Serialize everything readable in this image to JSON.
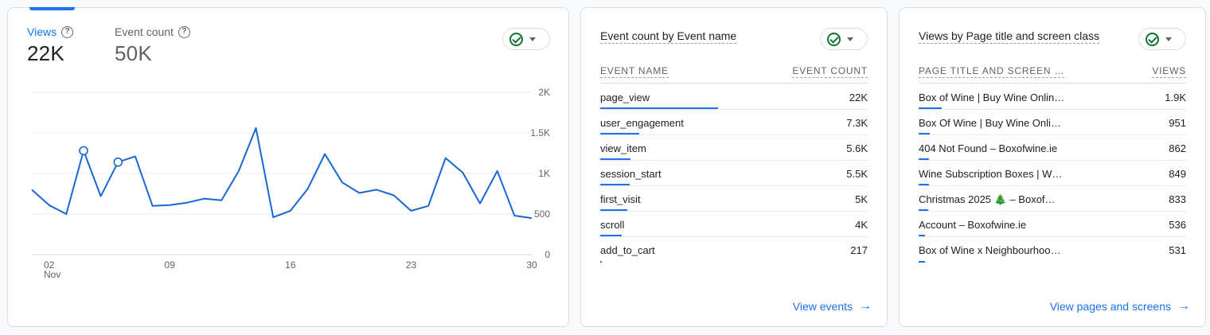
{
  "views_card": {
    "metrics": [
      {
        "label": "Views",
        "value": "22K"
      },
      {
        "label": "Event count",
        "value": "50K"
      }
    ],
    "help_glyph": "?"
  },
  "chart_data": {
    "type": "line",
    "series": [
      {
        "name": "Views",
        "values": [
          800,
          610,
          500,
          1280,
          720,
          1140,
          1210,
          600,
          610,
          640,
          690,
          670,
          1030,
          1560,
          460,
          540,
          810,
          1240,
          890,
          760,
          800,
          730,
          540,
          600,
          1190,
          1010,
          630,
          1030,
          480,
          450
        ]
      }
    ],
    "x": [
      "Nov 1",
      "Nov 2",
      "Nov 3",
      "Nov 4",
      "Nov 5",
      "Nov 6",
      "Nov 7",
      "Nov 8",
      "Nov 9",
      "Nov 10",
      "Nov 11",
      "Nov 12",
      "Nov 13",
      "Nov 14",
      "Nov 15",
      "Nov 16",
      "Nov 17",
      "Nov 18",
      "Nov 19",
      "Nov 20",
      "Nov 21",
      "Nov 22",
      "Nov 23",
      "Nov 24",
      "Nov 25",
      "Nov 26",
      "Nov 27",
      "Nov 28",
      "Nov 29",
      "Nov 30"
    ],
    "x_ticks": [
      {
        "label": "02",
        "sub": "Nov"
      },
      {
        "label": "09",
        "sub": ""
      },
      {
        "label": "16",
        "sub": ""
      },
      {
        "label": "23",
        "sub": ""
      },
      {
        "label": "30",
        "sub": ""
      }
    ],
    "x_tick_days": [
      2,
      9,
      16,
      23,
      30
    ],
    "y_ticks": [
      "0",
      "500",
      "1K",
      "1.5K",
      "2K"
    ],
    "y_tick_values": [
      0,
      500,
      1000,
      1500,
      2000
    ],
    "ylim": [
      0,
      2000
    ],
    "annotation_days": [
      4,
      6
    ],
    "grid": true,
    "line_color": "#1967d2"
  },
  "events_card": {
    "title": "Event count by Event name",
    "col_left": "EVENT NAME",
    "col_right": "EVENT COUNT",
    "rows": [
      {
        "name": "page_view",
        "value": "22K",
        "fraction": 0.44
      },
      {
        "name": "user_engagement",
        "value": "7.3K",
        "fraction": 0.146
      },
      {
        "name": "view_item",
        "value": "5.6K",
        "fraction": 0.112
      },
      {
        "name": "session_start",
        "value": "5.5K",
        "fraction": 0.11
      },
      {
        "name": "first_visit",
        "value": "5K",
        "fraction": 0.1
      },
      {
        "name": "scroll",
        "value": "4K",
        "fraction": 0.08
      },
      {
        "name": "add_to_cart",
        "value": "217",
        "fraction": 0.005
      }
    ],
    "link": "View events"
  },
  "pages_card": {
    "title": "Views by Page title and screen class",
    "col_left": "PAGE TITLE AND SCREEN …",
    "col_right": "VIEWS",
    "rows": [
      {
        "name": "Box of Wine | Buy Wine Onlin…",
        "value": "1.9K",
        "fraction": 0.086
      },
      {
        "name": "Box Of Wine | Buy Wine Onli…",
        "value": "951",
        "fraction": 0.043
      },
      {
        "name": "404 Not Found – Boxofwine.ie",
        "value": "862",
        "fraction": 0.039
      },
      {
        "name": "Wine Subscription Boxes | W…",
        "value": "849",
        "fraction": 0.038
      },
      {
        "name": "Christmas 2025 🎄 – Boxof…",
        "value": "833",
        "fraction": 0.037
      },
      {
        "name": "Account – Boxofwine.ie",
        "value": "536",
        "fraction": 0.024
      },
      {
        "name": "Box of Wine x Neighbourhoo…",
        "value": "531",
        "fraction": 0.024
      }
    ],
    "link": "View pages and screens"
  },
  "icons": {
    "help": "help-circle-icon",
    "status": "check-circle-icon",
    "dropdown": "chevron-down-icon",
    "link": "arrow-right-icon"
  },
  "colors": {
    "accent": "#1a73e8",
    "status_green": "#137333"
  }
}
